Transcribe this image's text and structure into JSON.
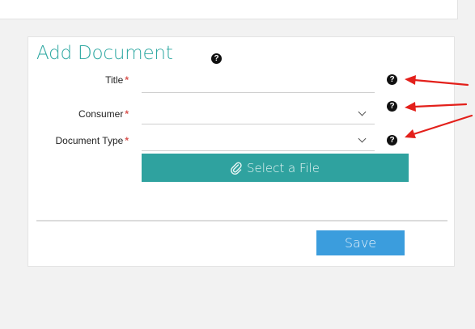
{
  "form": {
    "title": "Add Document",
    "help_glyph": "?",
    "fields": [
      {
        "label": "Title",
        "required_mark": "*",
        "value": "",
        "type": "text"
      },
      {
        "label": "Consumer",
        "required_mark": "*",
        "value": "",
        "type": "select"
      },
      {
        "label": "Document Type",
        "required_mark": "*",
        "value": "",
        "type": "select"
      }
    ],
    "select_file_label": "Select a File",
    "save_label": "Save"
  },
  "icons": {
    "help": "question-circle-icon",
    "chevron": "chevron-down-icon",
    "attach": "paperclip-icon"
  },
  "colors": {
    "title": "#2ea8a2",
    "select_file_button": "#2fa29f",
    "save_button": "#3b9ddd",
    "required": "#d9534f",
    "annotation_arrows": "#e3201b"
  }
}
